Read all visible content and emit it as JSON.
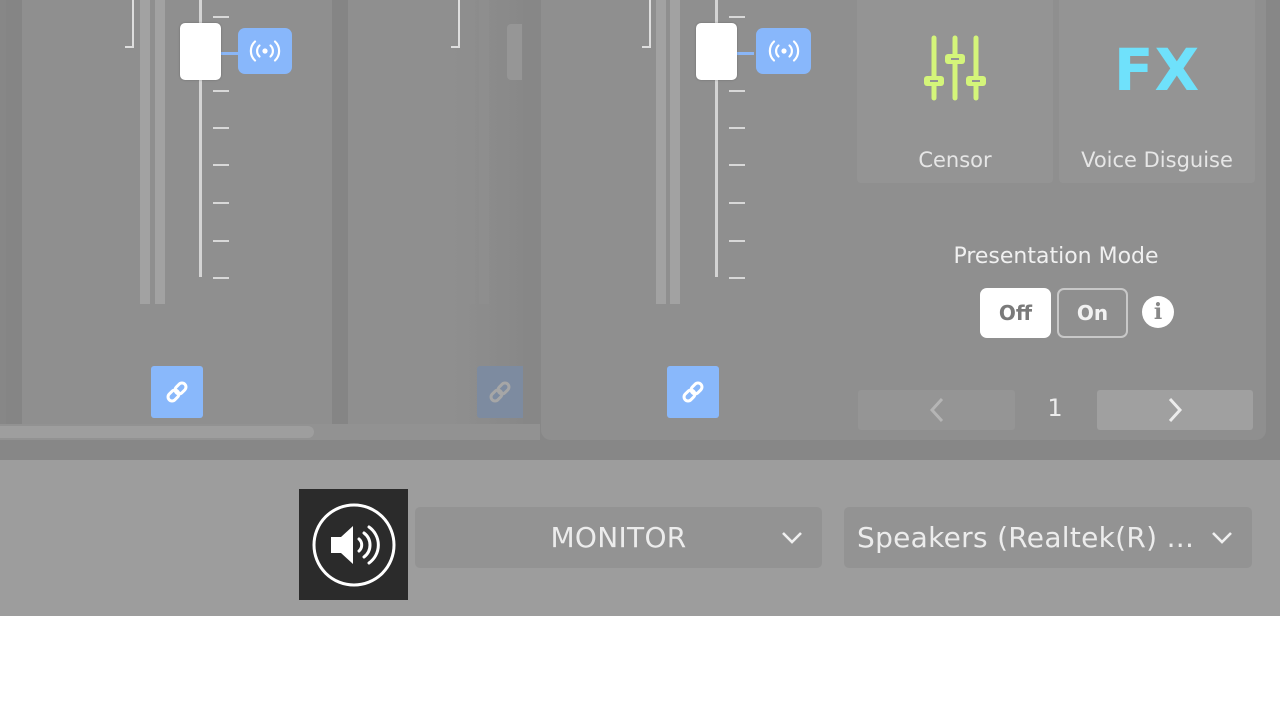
{
  "mixer": {
    "channels": [
      {
        "id": "channel-1",
        "fader_level_db_label": "",
        "broadcast_icon": "broadcast-icon",
        "link_icon": "link-icon",
        "linked": true
      },
      {
        "id": "channel-2",
        "broadcast_icon": "",
        "link_icon": "link-icon",
        "linked": false
      },
      {
        "id": "channel-3",
        "broadcast_icon": "broadcast-icon",
        "link_icon": "link-icon",
        "linked": true
      }
    ]
  },
  "effects": {
    "cards": [
      {
        "label": "Censor",
        "icon": "sliders-icon",
        "color": "#d4f57a"
      },
      {
        "label": "Voice Disguise",
        "icon": "fx-icon",
        "icon_text": "FX",
        "color": "#6fe1fb"
      }
    ]
  },
  "presentation_mode": {
    "label": "Presentation Mode",
    "options": [
      "Off",
      "On"
    ],
    "selected": "Off"
  },
  "pager": {
    "page": "1",
    "prev_icon": "chevron-left-icon",
    "next_icon": "chevron-right-icon"
  },
  "output": {
    "speaker_icon": "speaker-volume-icon",
    "mix_select": {
      "value": "MONITOR"
    },
    "device_select": {
      "value": "Speakers (Realtek(R) ..."
    }
  },
  "colors": {
    "accent_blue": "#88b7fb",
    "censor_green": "#d4f57a",
    "fx_cyan": "#6fe1fb"
  }
}
